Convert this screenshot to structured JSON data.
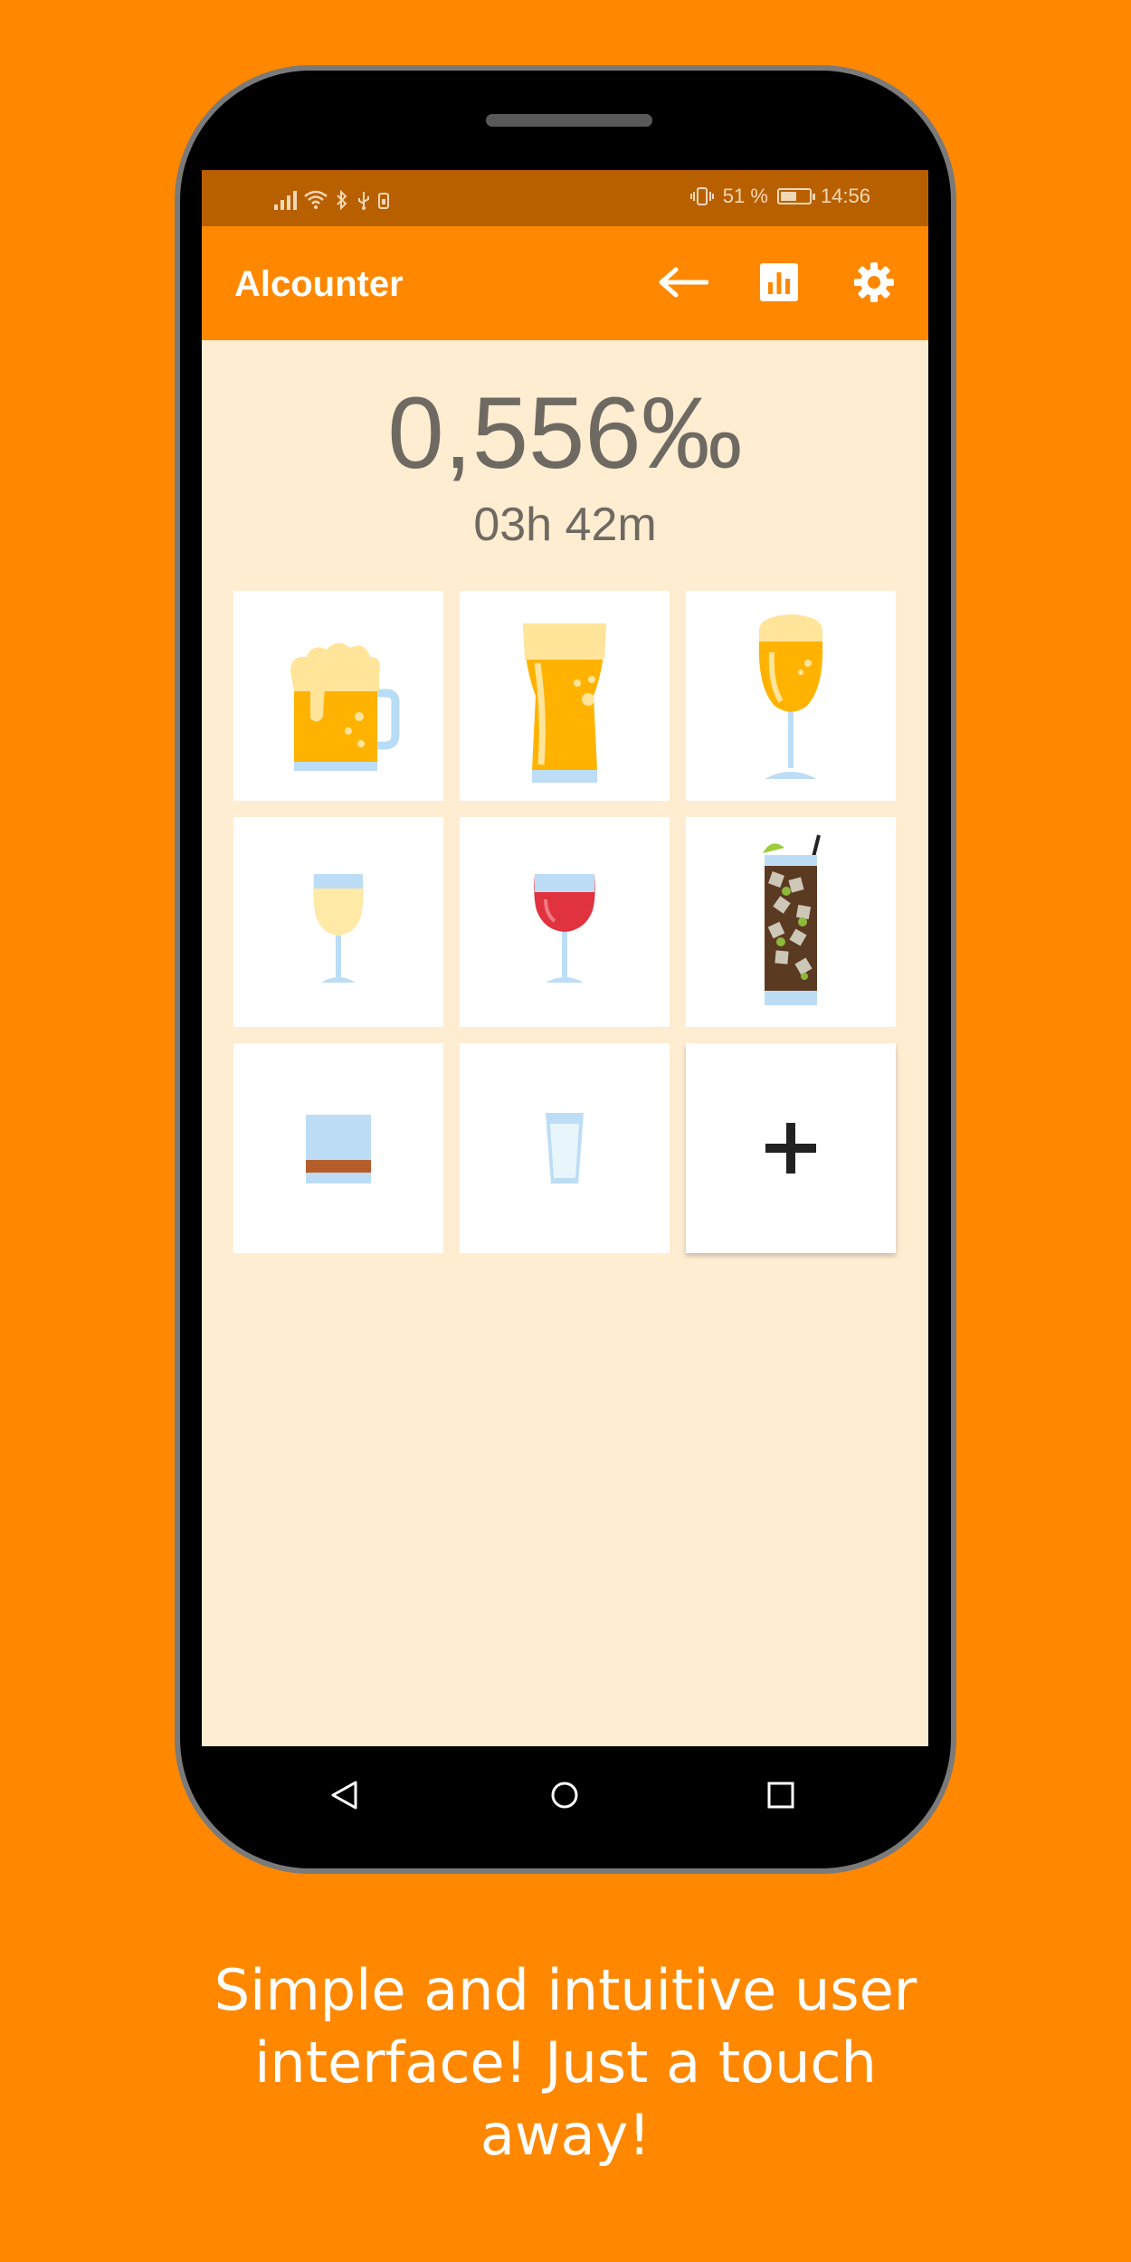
{
  "status_bar": {
    "battery_percent": "51 %",
    "time": "14:56",
    "icons": [
      "signal-icon",
      "wifi-icon",
      "bluetooth-icon",
      "usb-icon",
      "sim-icon",
      "vibrate-icon",
      "battery-icon"
    ]
  },
  "app_bar": {
    "title": "Alcounter",
    "actions": [
      "back-arrow-icon",
      "stats-icon",
      "gear-icon"
    ]
  },
  "main": {
    "bac_value": "0,556‰",
    "time_remaining": "03h 42m"
  },
  "drinks": [
    {
      "name": "beer-mug-icon"
    },
    {
      "name": "beer-pint-glass-icon"
    },
    {
      "name": "beer-tulip-glass-icon"
    },
    {
      "name": "white-wine-glass-icon"
    },
    {
      "name": "red-wine-glass-icon"
    },
    {
      "name": "cocktail-glass-icon"
    },
    {
      "name": "whiskey-glass-icon"
    },
    {
      "name": "shot-glass-icon"
    },
    {
      "name": "add-drink-icon"
    }
  ],
  "nav_bar": [
    "back-triangle-icon",
    "home-circle-icon",
    "recents-square-icon"
  ],
  "caption": {
    "line1": "Simple and intuitive user",
    "line2": "interface! Just a touch",
    "line3": "away!"
  },
  "colors": {
    "background": "#FF8800",
    "status_bar": "#B86000",
    "app_bar": "#FF8800",
    "screen": "#FFEDD2",
    "text": "#6E6A62"
  }
}
